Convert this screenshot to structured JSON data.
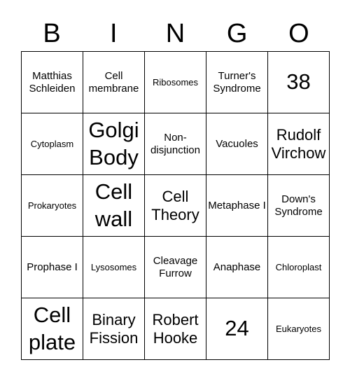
{
  "header": [
    "B",
    "I",
    "N",
    "G",
    "O"
  ],
  "cells": [
    "Matthias Schleiden",
    "Cell membrane",
    "Ribosomes",
    "Turner's Syndrome",
    "38",
    "Cytoplasm",
    "Golgi Body",
    "Non-disjunction",
    "Vacuoles",
    "Rudolf Virchow",
    "Prokaryotes",
    "Cell wall",
    "Cell Theory",
    "Metaphase I",
    "Down's Syndrome",
    "Prophase I",
    "Lysosomes",
    "Cleavage Furrow",
    "Anaphase",
    "Chloroplast",
    "Cell plate",
    "Binary Fission",
    "Robert Hooke",
    "24",
    "Eukaryotes"
  ]
}
